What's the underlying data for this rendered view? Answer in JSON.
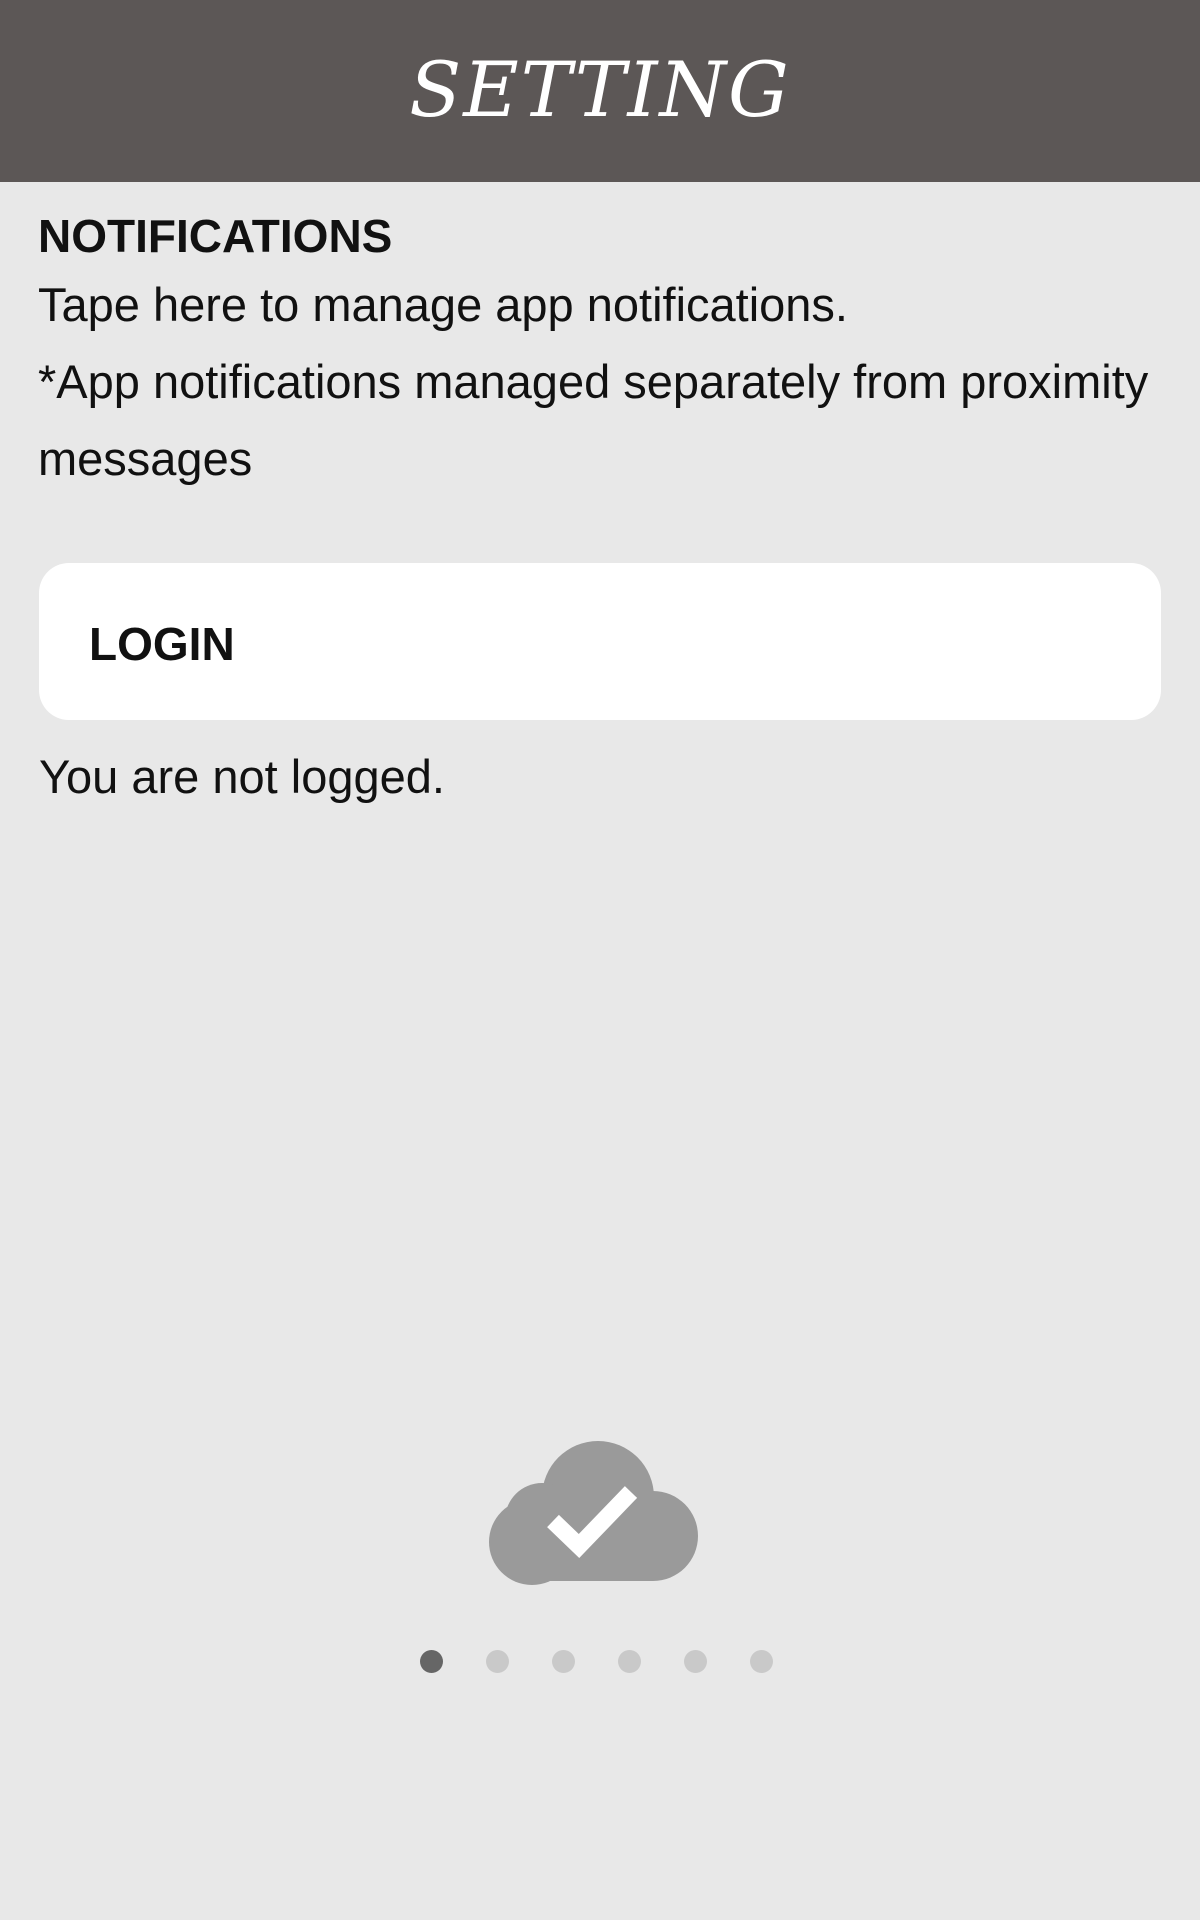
{
  "header": {
    "title": "SETTING"
  },
  "notifications": {
    "title": "NOTIFICATIONS",
    "description_line1": "Tape here to manage app notifications.",
    "description_line2": "*App notifications managed separately from proximity messages"
  },
  "login": {
    "button_label": "LOGIN",
    "status_text": "You are not logged."
  },
  "status_icon": "cloud-check-icon",
  "pager": {
    "page_count": 6,
    "active_index": 0
  },
  "colors": {
    "header_bg": "#5c5756",
    "page_bg": "#e8e8e8",
    "card_bg": "#ffffff",
    "icon_gray": "#9a9a9a",
    "dot_active": "#666666",
    "dot_inactive": "#c9c9c9"
  }
}
